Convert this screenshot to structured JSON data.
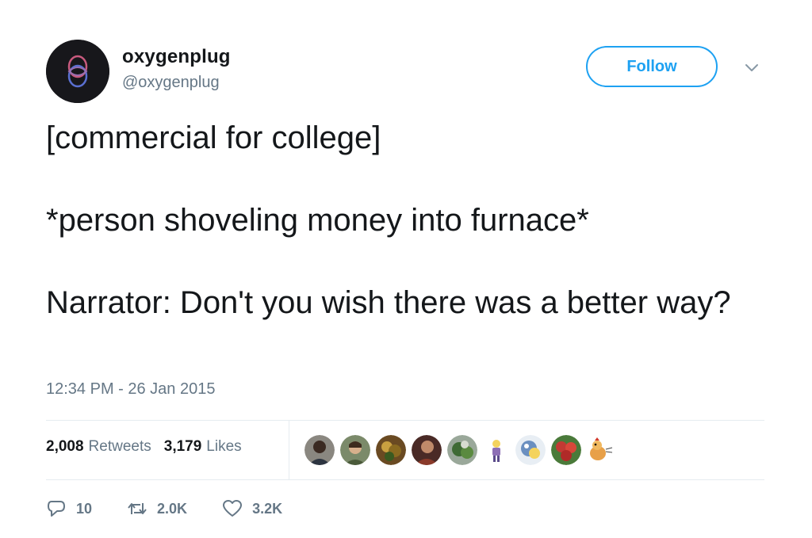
{
  "user": {
    "display_name": "oxygenplug",
    "handle": "@oxygenplug"
  },
  "follow_label": "Follow",
  "tweet": {
    "lines": [
      "[commercial for college]",
      "*person shoveling money into furnace*",
      "Narrator: Don't you wish there was a better way?"
    ],
    "timestamp": "12:34 PM - 26 Jan 2015"
  },
  "stats": {
    "retweets_count": "2,008",
    "retweets_label": "Retweets",
    "likes_count": "3,179",
    "likes_label": "Likes"
  },
  "liker_avatars": [
    {
      "icon": "avatar-person-dark",
      "color": "#5a5550"
    },
    {
      "icon": "avatar-person-green",
      "color": "#6d7b5a"
    },
    {
      "icon": "avatar-plant",
      "color": "#7a5a2a"
    },
    {
      "icon": "avatar-person-red",
      "color": "#6b3a30"
    },
    {
      "icon": "avatar-nature",
      "color": "#4f6e46"
    },
    {
      "icon": "avatar-cartoon-purple",
      "color": "#8d6fb5"
    },
    {
      "icon": "avatar-cartoon-blue",
      "color": "#6a8fc0"
    },
    {
      "icon": "avatar-strawberries",
      "color": "#c23a33"
    },
    {
      "icon": "avatar-cartoon-chicken",
      "color": "#d58a3a"
    }
  ],
  "actions": {
    "reply_count": "10",
    "retweet_count": "2.0K",
    "like_count": "3.2K"
  },
  "colors": {
    "accent": "#1da1f2",
    "text": "#14171a",
    "muted": "#657786",
    "border": "#e6ecf0"
  }
}
